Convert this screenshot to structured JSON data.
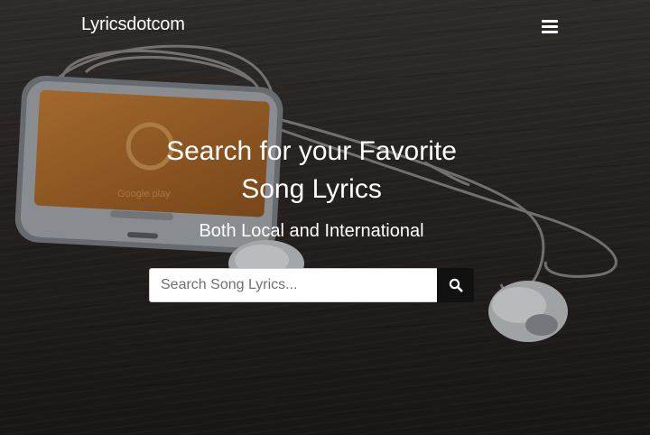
{
  "navbar": {
    "brand": "Lyricsdotcom",
    "menu_icon": "hamburger-menu-icon"
  },
  "hero": {
    "headline": "Search for your Favorite Song Lyrics",
    "subheadline": "Both Local and International",
    "phone_screen_text": "Google play"
  },
  "search": {
    "placeholder": "Search Song Lyrics...",
    "value": "",
    "button_icon": "search-icon"
  },
  "colors": {
    "text": "#ffffff",
    "search_button": "#111111",
    "phone_screen": "#b8702a",
    "background": "#2c2826"
  }
}
